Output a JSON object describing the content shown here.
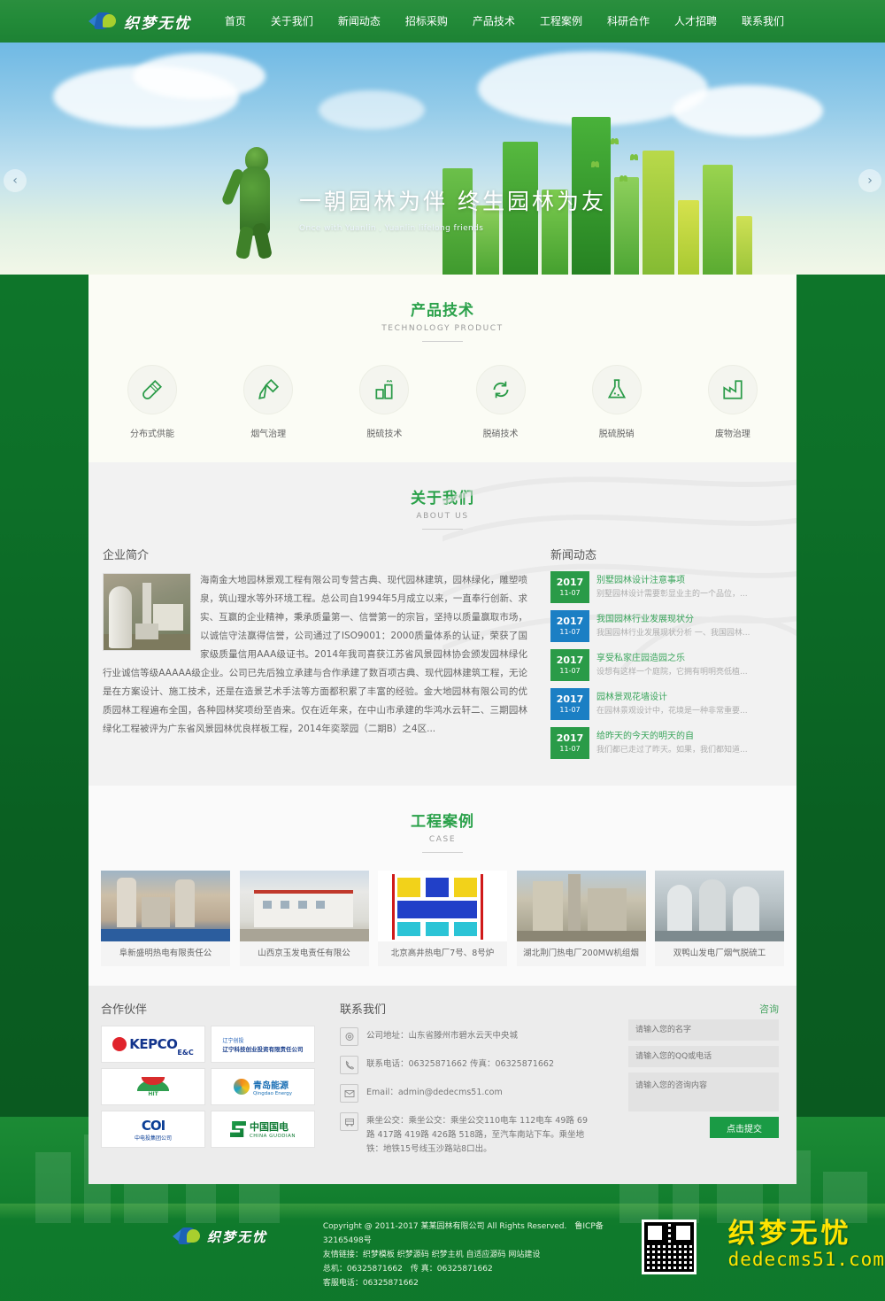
{
  "header": {
    "logo_text": "织梦无忧",
    "nav": [
      {
        "label": "首页"
      },
      {
        "label": "关于我们"
      },
      {
        "label": "新闻动态"
      },
      {
        "label": "招标采购"
      },
      {
        "label": "产品技术"
      },
      {
        "label": "工程案例"
      },
      {
        "label": "科研合作"
      },
      {
        "label": "人才招聘"
      },
      {
        "label": "联系我们"
      }
    ]
  },
  "banner": {
    "title": "一朝园林为伴   终生园林为友",
    "subtitle": "Once with Yuanlin , Yuanlin lifelong friends",
    "prev": "‹",
    "next": "›"
  },
  "products": {
    "title": "产品技术",
    "subtitle": "TECHNOLOGY PRODUCT",
    "items": [
      {
        "label": "分布式供能",
        "icon": "test-tube-icon"
      },
      {
        "label": "烟气治理",
        "icon": "dropper-icon"
      },
      {
        "label": "脱硫技术",
        "icon": "factory-smoke-icon"
      },
      {
        "label": "脱硝技术",
        "icon": "recycle-icon"
      },
      {
        "label": "脱硫脱硝",
        "icon": "flask-icon"
      },
      {
        "label": "废物治理",
        "icon": "factory-chart-icon"
      }
    ]
  },
  "about": {
    "title": "关于我们",
    "subtitle": "ABOUT US",
    "profile_heading": "企业简介",
    "profile_text": "海南金大地园林景观工程有限公司专营古典、现代园林建筑，园林绿化，雕塑喷泉，筑山理水等外环境工程。总公司自1994年5月成立以来，一直奉行创新、求实、互赢的企业精神，秉承质量第一、信誉第一的宗旨，坚持以质量赢取市场，以诚信守法赢得信誉，公司通过了ISO9001：2000质量体系的认证，荣获了国家级质量信用AAA级证书。2014年我司喜获江苏省风景园林协会颁发园林绿化行业诚信等级AAAAA级企业。公司已先后独立承建与合作承建了数百项古典、现代园林建筑工程，无论是在方案设计、施工技术，还是在造景艺术手法等方面都积累了丰富的经验。金大地园林有限公司的优质园林工程遍布全国，各种园林奖项纷至沓来。仅在近年来，在中山市承建的华鸿水云轩二、三期园林绿化工程被评为广东省风景园林优良样板工程，2014年奕翠园（二期B）之4区...",
    "news_heading": "新闻动态",
    "news": [
      {
        "year": "2017",
        "date": "11-07",
        "title": "别墅园林设计注意事项",
        "desc": "别墅园林设计需要彰显业主的一个品位，...",
        "color": "#2a9b48"
      },
      {
        "year": "2017",
        "date": "11-07",
        "title": "我国园林行业发展现状分",
        "desc": "我国园林行业发展现状分析 一、我国园林...",
        "color": "#1b7fc4"
      },
      {
        "year": "2017",
        "date": "11-07",
        "title": "享受私家庄园造园之乐",
        "desc": "设想有这样一个庭院，它拥有明明亮低植...",
        "color": "#2a9b48"
      },
      {
        "year": "2017",
        "date": "11-07",
        "title": "园林景观花墙设计",
        "desc": "在园林景观设计中，花境是一种非常重要...",
        "color": "#1b7fc4"
      },
      {
        "year": "2017",
        "date": "11-07",
        "title": "给昨天的今天的明天的自",
        "desc": "我们都已走过了昨天。如果，我们都知道...",
        "color": "#2a9b48"
      }
    ]
  },
  "cases": {
    "title": "工程案例",
    "subtitle": "CASE",
    "items": [
      {
        "caption": "阜新盛明热电有限责任公"
      },
      {
        "caption": "山西京玉发电责任有限公"
      },
      {
        "caption": "北京高井热电厂7号、8号炉"
      },
      {
        "caption": "湖北荆门热电厂200MW机组烟"
      },
      {
        "caption": "双鸭山发电厂烟气脱硫工"
      }
    ]
  },
  "partners": {
    "heading": "合作伙伴",
    "logos": [
      {
        "name": "KEPCO",
        "sub": "E&C"
      },
      {
        "name": "辽宁科技创业投资有限责任公司",
        "sub": "辽宁创投"
      },
      {
        "name": "HIT",
        "sub": ""
      },
      {
        "name": "青岛能源",
        "sub": "Qingdao Energy"
      },
      {
        "name": "中电投集团公司",
        "sub": "COI"
      },
      {
        "name": "中国国电",
        "sub": "CHINA GUODIAN"
      }
    ]
  },
  "contact": {
    "heading": "联系我们",
    "consult_label": "咨询",
    "rows": [
      {
        "icon": "location-icon",
        "text": "公司地址：山东省滕州市碧水云天中央城"
      },
      {
        "icon": "phone-icon",
        "text": "联系电话：06325871662        传真：06325871662"
      },
      {
        "icon": "mail-icon",
        "text": "Email：admin@dedecms51.com"
      },
      {
        "icon": "bus-icon",
        "text": "乘坐公交：乘坐公交：乘坐公交110电车 112电车 49路 69路 417路 419路 426路 518路，至汽车南站下车。乘坐地铁：地铁15号线玉沙路站8口出。"
      }
    ],
    "form": {
      "name_placeholder": "请输入您的名字",
      "qq_placeholder": "请输入您的QQ或电话",
      "message_placeholder": "请输入您的咨询内容",
      "submit_label": "点击提交"
    }
  },
  "footer": {
    "logo_text": "织梦无忧",
    "copyright": "Copyright @ 2011-2017 某某园林有限公司 All Rights Reserved.　鲁ICP备32165498号",
    "links_label": "友情链接：",
    "links": "织梦模板 织梦源码 织梦主机 自适应源码 网站建设",
    "phone_line": "总机：06325871662　传 真：06325871662",
    "service_line": "客服电话：06325871662",
    "watermark_cn": "织梦无忧",
    "watermark_en": "dedecms51.com"
  },
  "colors": {
    "brand_green": "#2a9b48",
    "nav_green": "#228a38",
    "accent_blue": "#1b7fc4",
    "watermark_yellow": "#ffe400"
  }
}
